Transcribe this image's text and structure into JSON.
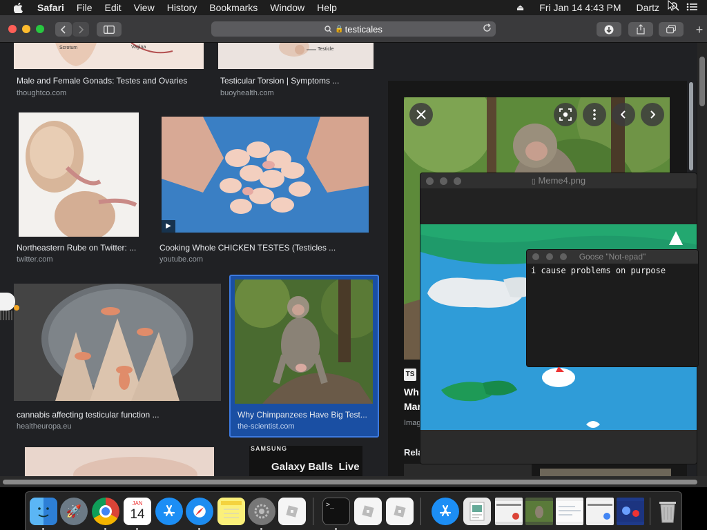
{
  "menubar": {
    "app": "Safari",
    "items": [
      "File",
      "Edit",
      "View",
      "History",
      "Bookmarks",
      "Window",
      "Help"
    ],
    "datetime": "Fri Jan 14  4:43 PM",
    "user": "Dartz"
  },
  "address": {
    "query": "testicales",
    "lock": "🔒"
  },
  "results": [
    {
      "title": "Male and Female Gonads: Testes and Ovaries",
      "source": "thoughtco.com",
      "img_text_1": "Scrotum",
      "img_text_2": "Vagina"
    },
    {
      "title": "Testicular Torsion | Symptoms ...",
      "source": "buoyhealth.com",
      "img_text": "Testicle"
    },
    {
      "title": "Northeastern Rube on Twitter: ...",
      "source": "twitter.com"
    },
    {
      "title": "Cooking Whole CHICKEN TESTES (Testicles ...",
      "source": "youtube.com"
    },
    {
      "title": "cannabis affecting testicular function ...",
      "source": "healtheuropa.eu"
    },
    {
      "title": "Why Chimpanzees Have Big Test...",
      "source": "the-scientist.com"
    },
    {
      "badge_top": "SAMSUNG",
      "badge_text": "Galaxy Balls  Live"
    }
  ],
  "preview": {
    "site_badge": "TS",
    "title_fragment_1": "Wh",
    "title_fragment_2": "Mar",
    "images_label": "Imag",
    "related_label": "Rela"
  },
  "meme_window": {
    "title": "Meme4.png"
  },
  "goose_window": {
    "title": "Goose \"Not-epad\"",
    "text": "i cause problems on purpose"
  },
  "dock": {
    "calendar_month": "JAN",
    "calendar_day": "14",
    "apps": [
      "Finder",
      "Launchpad",
      "Chrome",
      "Calendar",
      "App Store",
      "Safari",
      "Notes",
      "System Preferences",
      "Roblox",
      "Terminal",
      "Roblox",
      "Roblox",
      "App Store",
      "Preview",
      "Window 1",
      "Window 2",
      "Window 3",
      "Window 4",
      "Window 5",
      "Trash"
    ]
  }
}
